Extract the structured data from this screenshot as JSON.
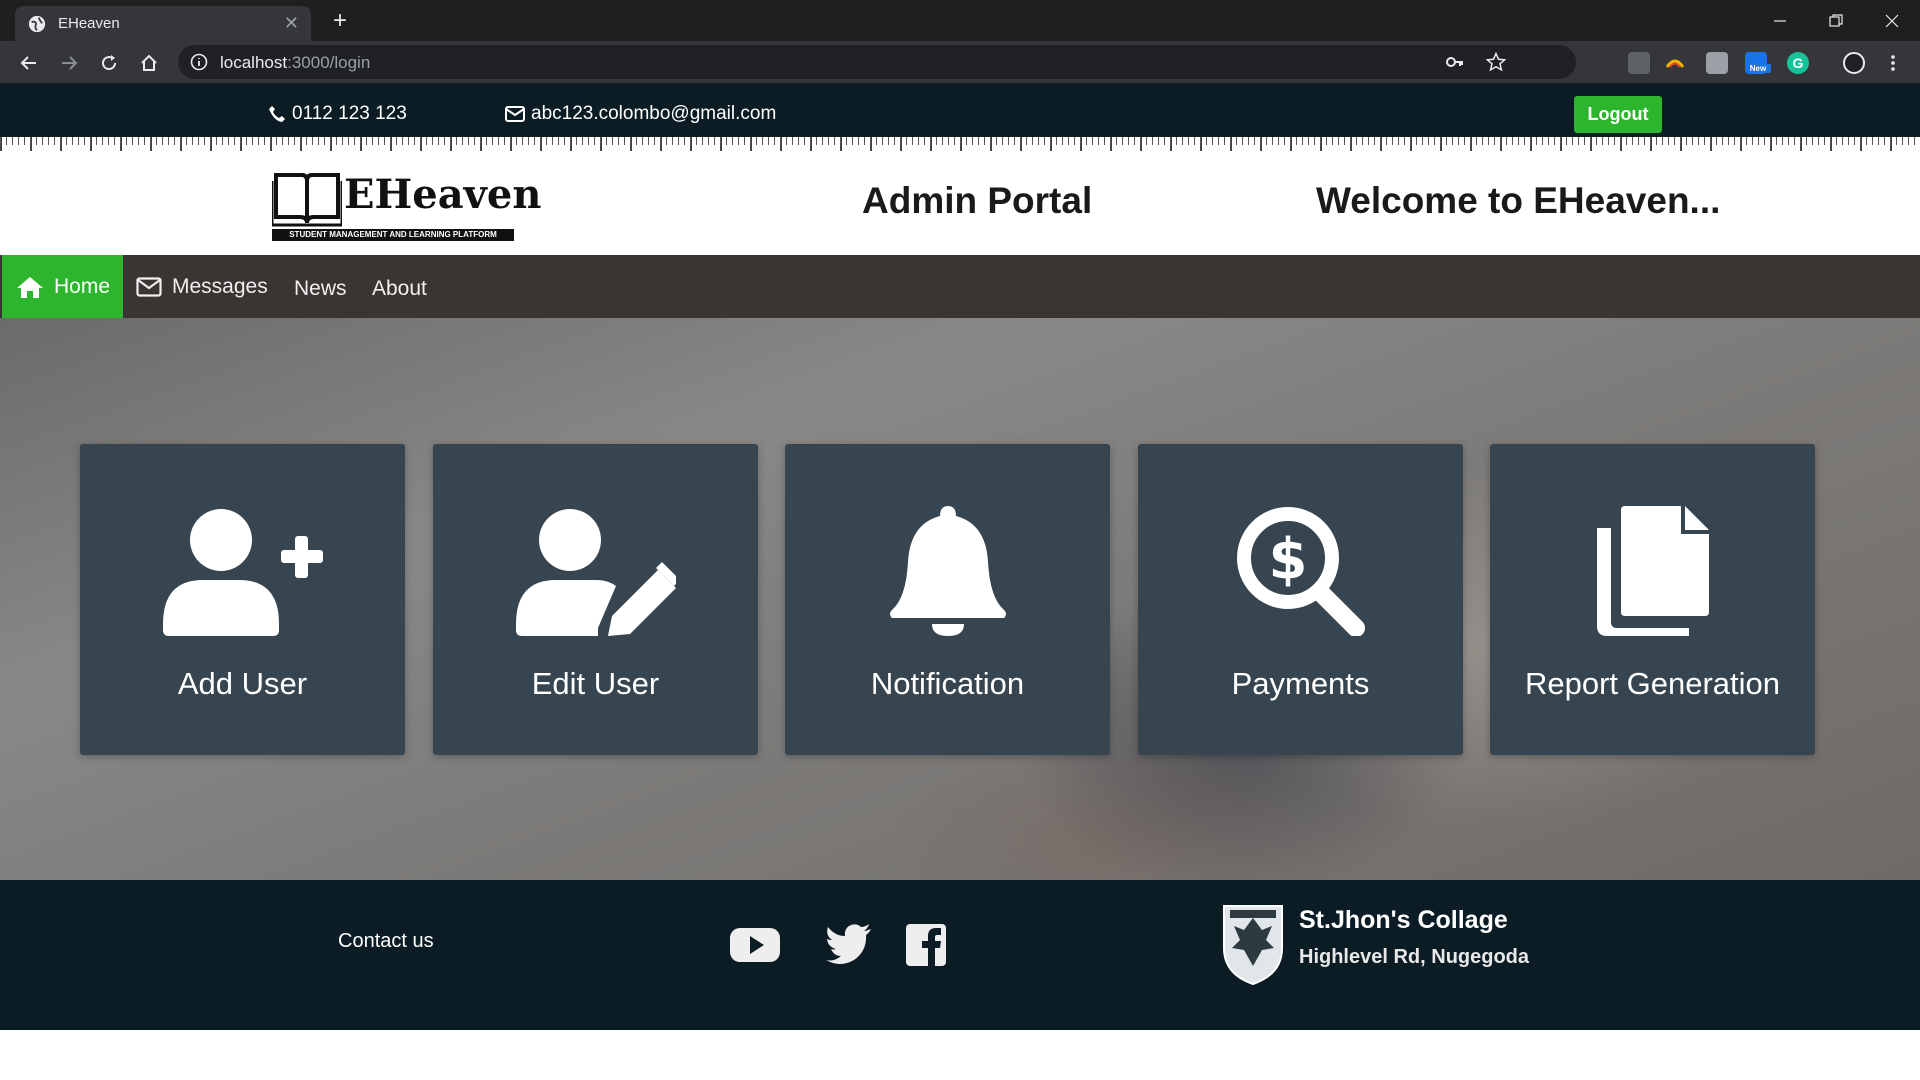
{
  "browser": {
    "tab_title": "EHeaven",
    "url_host": "localhost",
    "url_rest": ":3000/login",
    "new_badge": "New"
  },
  "topbar": {
    "phone": "0112 123 123",
    "email": "abc123.colombo@gmail.com",
    "logout_label": "Logout"
  },
  "header": {
    "logo_text": "EHeaven",
    "logo_tagline": "STUDENT MANAGEMENT AND LEARNING PLATFORM",
    "portal_title": "Admin Portal",
    "welcome": "Welcome to EHeaven..."
  },
  "nav": {
    "items": [
      {
        "label": "Home",
        "icon": "home-icon",
        "active": true
      },
      {
        "label": "Messages",
        "icon": "envelope-icon",
        "active": false
      },
      {
        "label": "News"
      },
      {
        "label": "About"
      }
    ]
  },
  "tiles": [
    {
      "label": "Add User",
      "icon": "user-plus-icon"
    },
    {
      "label": "Edit User",
      "icon": "user-edit-icon"
    },
    {
      "label": "Notification",
      "icon": "bell-icon"
    },
    {
      "label": "Payments",
      "icon": "search-dollar-icon"
    },
    {
      "label": "Report Generation",
      "icon": "copy-file-icon"
    }
  ],
  "footer": {
    "contact_label": "Contact us",
    "school_name": "St.Jhon's Collage",
    "school_address": "Highlevel Rd, Nugegoda"
  },
  "colors": {
    "accent_green": "#2db52d",
    "dark_navy": "#0b1c24",
    "tile_bg": "#36454f",
    "nav_bg": "#3a3532"
  }
}
